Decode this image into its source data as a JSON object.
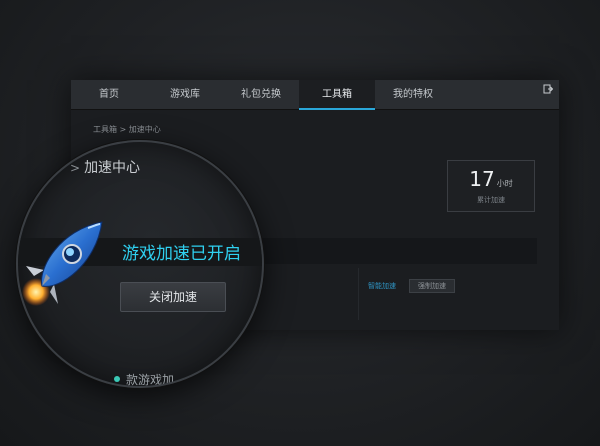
{
  "navbar": {
    "tabs": [
      {
        "label": "首页"
      },
      {
        "label": "游戏库"
      },
      {
        "label": "礼包兑换"
      },
      {
        "label": "工具箱"
      },
      {
        "label": "我的特权"
      }
    ],
    "active_tab": "工具箱"
  },
  "breadcrumb": "工具箱 > 加速中心",
  "stats": {
    "value": "17",
    "unit": "小时",
    "label": "累计加速"
  },
  "row": {
    "link": "智能加速",
    "button": "强制加速"
  },
  "magnifier": {
    "title": "加速中心",
    "status": "游戏加速已开启",
    "button": "关闭加速",
    "footer": "款游戏加"
  },
  "colors": {
    "accent": "#2aa7d8",
    "status": "#2fd0f0"
  }
}
